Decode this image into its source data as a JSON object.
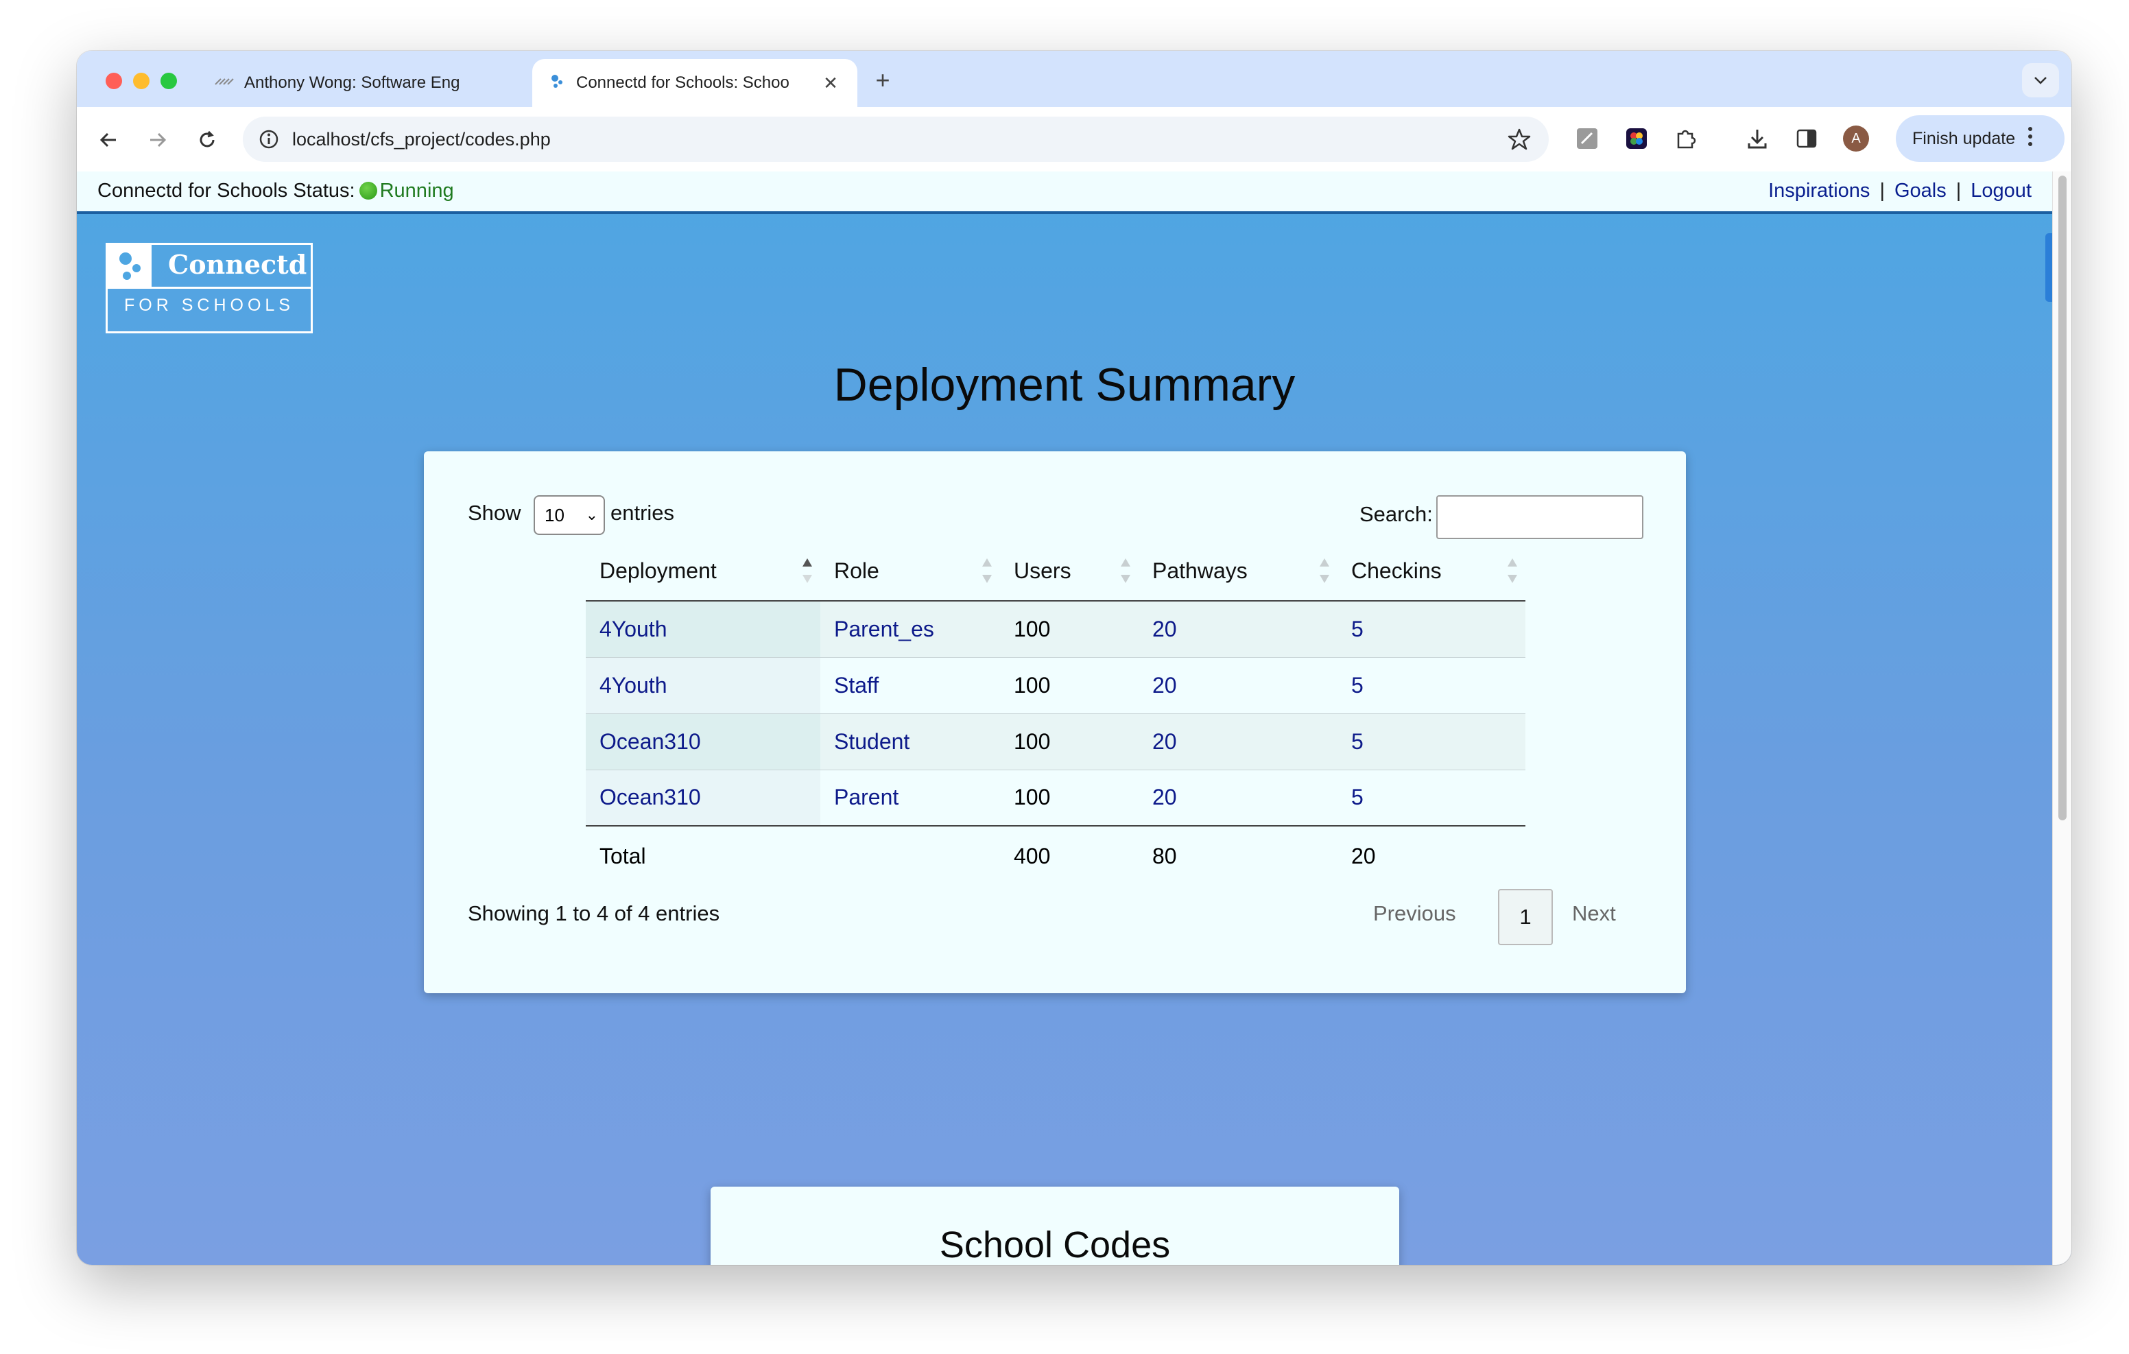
{
  "browser": {
    "tabs": [
      {
        "title": "Anthony Wong: Software Eng",
        "active": false
      },
      {
        "title": "Connectd for Schools: Schoo",
        "active": true
      }
    ],
    "url": "localhost/cfs_project/codes.php",
    "finish_update_label": "Finish update",
    "profile_initial": "A"
  },
  "status_bar": {
    "label": "Connectd for Schools Status:",
    "value": "Running",
    "links": [
      "Inspirations",
      "Goals",
      "Logout"
    ],
    "separator": "|"
  },
  "logo": {
    "name": "Connectd",
    "subtitle": "FOR SCHOOLS"
  },
  "deployment_summary": {
    "title": "Deployment Summary",
    "show_label": "Show",
    "entries_label": "entries",
    "page_length": "10",
    "search_label": "Search:",
    "search_value": "",
    "columns": [
      "Deployment",
      "Role",
      "Users",
      "Pathways",
      "Checkins"
    ],
    "rows": [
      {
        "deployment": "4Youth",
        "role": "Parent_es",
        "users": "100",
        "pathways": "20",
        "checkins": "5"
      },
      {
        "deployment": "4Youth",
        "role": "Staff",
        "users": "100",
        "pathways": "20",
        "checkins": "5"
      },
      {
        "deployment": "Ocean310",
        "role": "Student",
        "users": "100",
        "pathways": "20",
        "checkins": "5"
      },
      {
        "deployment": "Ocean310",
        "role": "Parent",
        "users": "100",
        "pathways": "20",
        "checkins": "5"
      }
    ],
    "totals": {
      "label": "Total",
      "users": "400",
      "pathways": "80",
      "checkins": "20"
    },
    "info": "Showing 1 to 4 of 4 entries",
    "pagination": {
      "previous": "Previous",
      "current_page": "1",
      "next": "Next"
    }
  },
  "school_codes": {
    "title": "School Codes"
  },
  "colors": {
    "accent_link": "#0d1a8a",
    "status_running": "#1f7a1f",
    "page_gradient_top": "#4ea6e2",
    "page_gradient_bottom": "#7a9fe2"
  }
}
